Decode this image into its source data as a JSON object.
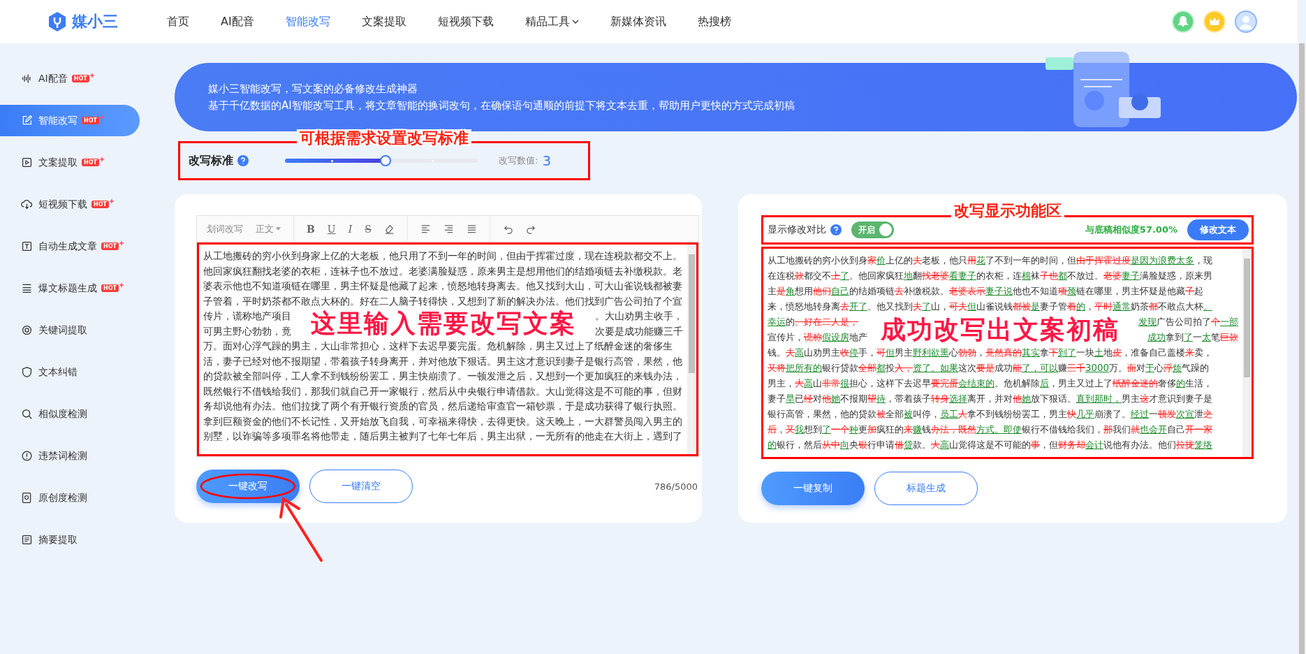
{
  "header": {
    "logo_text": "媒小三",
    "nav": [
      {
        "label": "首页",
        "selected": false,
        "dropdown": false
      },
      {
        "label": "AI配音",
        "selected": false,
        "dropdown": false
      },
      {
        "label": "智能改写",
        "selected": true,
        "dropdown": false
      },
      {
        "label": "文案提取",
        "selected": false,
        "dropdown": false
      },
      {
        "label": "短视频下载",
        "selected": false,
        "dropdown": false
      },
      {
        "label": "精品工具",
        "selected": false,
        "dropdown": true
      },
      {
        "label": "新媒体资讯",
        "selected": false,
        "dropdown": false
      },
      {
        "label": "热搜榜",
        "selected": false,
        "dropdown": false
      }
    ]
  },
  "sidebar": {
    "items": [
      {
        "label": "AI配音",
        "badge": "HOT",
        "selected": false
      },
      {
        "label": "智能改写",
        "badge": "HOT",
        "selected": true
      },
      {
        "label": "文案提取",
        "badge": "HOT",
        "selected": false
      },
      {
        "label": "短视频下载",
        "badge": "HOT",
        "selected": false
      },
      {
        "label": "自动生成文章",
        "badge": "HOT",
        "selected": false
      },
      {
        "label": "爆文标题生成",
        "badge": "HOT",
        "selected": false
      },
      {
        "label": "关键词提取",
        "selected": false
      },
      {
        "label": "文本纠错",
        "selected": false
      },
      {
        "label": "相似度检测",
        "selected": false
      },
      {
        "label": "违禁词检测",
        "selected": false
      },
      {
        "label": "原创度检测",
        "selected": false
      },
      {
        "label": "摘要提取",
        "selected": false
      }
    ]
  },
  "banner": {
    "title": "媒小三智能改写，写文案的必备修改生成神器",
    "subtitle": "基于千亿数据的AI智能改写工具，将文章智能的换词改句，在确保语句通顺的前提下将文本去重，帮助用户更快的方式完成初稿"
  },
  "rewrite_standard": {
    "label": "改写标准",
    "level": 0.5,
    "value_label": "改写数值:",
    "value": "3",
    "annotation": "可根据需求设置改写标准"
  },
  "editor": {
    "toolbar": {
      "mode": "划词改写",
      "style": "正文",
      "format_buttons": [
        {
          "kind": "bold",
          "label": "B"
        },
        {
          "kind": "underline",
          "label": "U"
        },
        {
          "kind": "italic",
          "label": "I"
        },
        {
          "kind": "strike",
          "label": "S"
        }
      ]
    },
    "annotation": "这里输入需要改写文案",
    "lines": [
      {
        "text": "从工地搬砖的穷小伙到身家上亿的大老板，他只用了不到一年的时间，但由于挥霍过度，现在连税款都交不上。"
      },
      {
        "text": "他回家疯狂翻找老婆的衣柜，连袜子也不放过。老婆满脸疑惑，原来男主是想用他们的结婚项链去补缴税款。老"
      },
      {
        "text": "婆表示他也不知道项链在哪里，男主怀疑是他藏了起来，愤怒地转身离去。他又找到大山，可大山雀说钱都被妻"
      },
      {
        "text": "子管着，平时奶茶都不敢点大杯的。好在二人脑子转得快，又想到了新的解决办法。他们找到广告公司拍了个宣"
      },
      {
        "text": "传片，谎称地产项目",
        "after_overlay": "。大山劝男主收手，"
      },
      {
        "text": "可男主野心勃勃，竟",
        "after_overlay": "次要是成功能赚三千"
      },
      {
        "text": "万。面对心浮气躁的男主，大山非常担心，这样下去迟早要完蛋。危机解除，男主又过上了纸醉金迷的奢侈生"
      },
      {
        "text": "活，妻子已经对他不报期望，带着孩子转身离开，并对他放下狠话。男主这才意识到妻子是银行高管，果然，他"
      },
      {
        "text": "的贷款被全部叫停，工人拿不到钱纷纷罢工，男主快崩溃了。一顿发泄之后，又想到一个更加疯狂的来钱办法，"
      },
      {
        "text": "既然银行不借钱给我们，那我们就自己开一家银行，然后从中央银行申请借款。大山觉得这是不可能的事，但财"
      },
      {
        "text": "务却说他有办法。他们拉拢了两个有开银行资质的官员，然后递给审查官一箱钞票，于是成功获得了银行执照。"
      },
      {
        "text": "拿到巨额资金的他们不长记性，又开始放飞自我，可幸福来得快，去得更快。这天晚上，一大群警员闯入男主的"
      },
      {
        "text": "别墅，以诈骗等多项罪名将他带走，随后男主被判了七年七年后，男主出狱，一无所有的他走在大街上，遇到了"
      }
    ],
    "buttons": [
      {
        "label": "一键改写",
        "kind": "primary"
      },
      {
        "label": "一键清空",
        "kind": "outline"
      }
    ],
    "count": "786/5000",
    "primary_annotated": true
  },
  "result": {
    "compare_label": "显示修改对比",
    "compare_on": true,
    "toggle_label": "开启",
    "similarity": "与底稿相似度57.00%",
    "edit_button": "修改文本",
    "annotation": "改写显示功能区",
    "overlay_annotation": "成功改写出文案初稿",
    "lines": [
      {
        "segments": [
          {
            "kind": "same",
            "text": "从工地搬砖的穷小伙到身"
          },
          {
            "kind": "deleted",
            "text": "家"
          },
          {
            "kind": "added",
            "text": "价"
          },
          {
            "kind": "same",
            "text": "上亿的"
          },
          {
            "kind": "deleted",
            "text": "夫"
          },
          {
            "kind": "same",
            "text": "老板，他只"
          },
          {
            "kind": "deleted",
            "text": "用"
          },
          {
            "kind": "added",
            "text": "花"
          },
          {
            "kind": "same",
            "text": "了不到一年的时间，但"
          },
          {
            "kind": "deleted",
            "text": "由于挥霍过度"
          },
          {
            "kind": "added",
            "text": "是因为浪费太多"
          },
          {
            "kind": "same",
            "text": "，现"
          }
        ]
      },
      {
        "segments": [
          {
            "kind": "same",
            "text": "在连税"
          },
          {
            "kind": "deleted",
            "text": "款"
          },
          {
            "kind": "same",
            "text": "都交不"
          },
          {
            "kind": "deleted",
            "text": "上"
          },
          {
            "kind": "added",
            "text": "了"
          },
          {
            "kind": "same",
            "text": "。他回家疯狂"
          },
          {
            "kind": "added",
            "text": "地"
          },
          {
            "kind": "same",
            "text": "翻"
          },
          {
            "kind": "deleted",
            "text": "找老婆"
          },
          {
            "kind": "added",
            "text": "看妻子"
          },
          {
            "kind": "same",
            "text": "的衣柜，连"
          },
          {
            "kind": "added",
            "text": "棉"
          },
          {
            "kind": "same",
            "text": "袜"
          },
          {
            "kind": "deleted",
            "text": "子也"
          },
          {
            "kind": "added",
            "text": "都"
          },
          {
            "kind": "same",
            "text": "不放过。"
          },
          {
            "kind": "deleted",
            "text": "老婆"
          },
          {
            "kind": "added",
            "text": "妻子"
          },
          {
            "kind": "same",
            "text": "满脸疑惑，原来男"
          }
        ]
      },
      {
        "segments": [
          {
            "kind": "same",
            "text": "主"
          },
          {
            "kind": "deleted",
            "text": "是"
          },
          {
            "kind": "added",
            "text": "角"
          },
          {
            "kind": "same",
            "text": "想用"
          },
          {
            "kind": "deleted",
            "text": "他们"
          },
          {
            "kind": "added",
            "text": "自己"
          },
          {
            "kind": "same",
            "text": "的结婚项链"
          },
          {
            "kind": "deleted",
            "text": "去"
          },
          {
            "kind": "same",
            "text": "补缴税款。"
          },
          {
            "kind": "deleted",
            "text": "老婆表示"
          },
          {
            "kind": "added",
            "text": "妻子说"
          },
          {
            "kind": "same",
            "text": "他也不知道"
          },
          {
            "kind": "deleted",
            "text": "项"
          },
          {
            "kind": "added",
            "text": "颈"
          },
          {
            "kind": "same",
            "text": "链在哪里，男主怀疑是他藏"
          },
          {
            "kind": "deleted",
            "text": "子"
          },
          {
            "kind": "same",
            "text": "起"
          }
        ]
      },
      {
        "segments": [
          {
            "kind": "same",
            "text": "来，愤怒地转身离"
          },
          {
            "kind": "deleted",
            "text": "去"
          },
          {
            "kind": "added",
            "text": "开了"
          },
          {
            "kind": "same",
            "text": "。他又找到"
          },
          {
            "kind": "deleted",
            "text": "夫"
          },
          {
            "kind": "added",
            "text": "了"
          },
          {
            "kind": "same",
            "text": "山，"
          },
          {
            "kind": "deleted",
            "text": "可夫"
          },
          {
            "kind": "added",
            "text": "但"
          },
          {
            "kind": "same",
            "text": "山雀说钱"
          },
          {
            "kind": "deleted",
            "text": "都被"
          },
          {
            "kind": "added",
            "text": "是"
          },
          {
            "kind": "same",
            "text": "妻子管"
          },
          {
            "kind": "deleted",
            "text": "着"
          },
          {
            "kind": "added",
            "text": "的"
          },
          {
            "kind": "same",
            "text": "，"
          },
          {
            "kind": "deleted",
            "text": "平时"
          },
          {
            "kind": "added",
            "text": "通常"
          },
          {
            "kind": "same",
            "text": "奶茶"
          },
          {
            "kind": "deleted",
            "text": "都"
          },
          {
            "kind": "same",
            "text": "不敢点大杯"
          },
          {
            "kind": "added",
            "text": "。"
          }
        ]
      },
      {
        "segments": [
          {
            "kind": "added",
            "text": "幸运"
          },
          {
            "kind": "same",
            "text": "的"
          },
          {
            "kind": "deleted",
            "text": "。好在二人是，"
          }
        ],
        "segments_after_overlay": [
          {
            "kind": "added",
            "text": "发现"
          },
          {
            "kind": "same",
            "text": "广告公司拍了"
          },
          {
            "kind": "deleted",
            "text": "个"
          },
          {
            "kind": "added",
            "text": "一部"
          }
        ]
      },
      {
        "segments": [
          {
            "kind": "same",
            "text": "宣传片，"
          },
          {
            "kind": "deleted",
            "text": "谎称"
          },
          {
            "kind": "added",
            "text": "假设房"
          },
          {
            "kind": "same",
            "text": "地产"
          }
        ],
        "segments_after_overlay": [
          {
            "kind": "added",
            "text": "成功"
          },
          {
            "kind": "same",
            "text": "拿到"
          },
          {
            "kind": "added",
            "text": "了"
          },
          {
            "kind": "same",
            "text": "一"
          },
          {
            "kind": "added",
            "text": "太"
          },
          {
            "kind": "same",
            "text": "笔"
          },
          {
            "kind": "deleted",
            "text": "巨款"
          }
        ]
      },
      {
        "segments": [
          {
            "kind": "same",
            "text": "钱。"
          },
          {
            "kind": "deleted",
            "text": "夫"
          },
          {
            "kind": "added",
            "text": "高"
          },
          {
            "kind": "same",
            "text": "山劝男主"
          },
          {
            "kind": "deleted",
            "text": "收"
          },
          {
            "kind": "added",
            "text": "停"
          },
          {
            "kind": "same",
            "text": "手，"
          },
          {
            "kind": "deleted",
            "text": "可"
          },
          {
            "kind": "added",
            "text": "但"
          },
          {
            "kind": "same",
            "text": "男主"
          },
          {
            "kind": "added",
            "text": "野利欲熏"
          },
          {
            "kind": "same",
            "text": "心"
          },
          {
            "kind": "deleted",
            "text": "勃勃"
          },
          {
            "kind": "same",
            "text": "，"
          },
          {
            "kind": "deleted",
            "text": "竟然真的"
          },
          {
            "kind": "added",
            "text": "其实"
          },
          {
            "kind": "same",
            "text": "拿"
          },
          {
            "kind": "deleted",
            "text": "下"
          },
          {
            "kind": "added",
            "text": "到了"
          },
          {
            "kind": "same",
            "text": "一块"
          },
          {
            "kind": "added",
            "text": "土"
          },
          {
            "kind": "same",
            "text": "地"
          },
          {
            "kind": "deleted",
            "text": "皮"
          },
          {
            "kind": "same",
            "text": "，准备自己盖楼"
          },
          {
            "kind": "deleted",
            "text": "来"
          },
          {
            "kind": "same",
            "text": "卖，"
          }
        ]
      },
      {
        "segments": [
          {
            "kind": "deleted",
            "text": "又将"
          },
          {
            "kind": "added",
            "text": "把所有的"
          },
          {
            "kind": "same",
            "text": "银行贷款"
          },
          {
            "kind": "deleted",
            "text": "全部"
          },
          {
            "kind": "added",
            "text": "都"
          },
          {
            "kind": "same",
            "text": "投"
          },
          {
            "kind": "deleted",
            "text": "入，"
          },
          {
            "kind": "added",
            "text": "资了。如果"
          },
          {
            "kind": "same",
            "text": "这次"
          },
          {
            "kind": "deleted",
            "text": "要是"
          },
          {
            "kind": "same",
            "text": "成功"
          },
          {
            "kind": "deleted",
            "text": "能"
          },
          {
            "kind": "added",
            "text": "了，可以"
          },
          {
            "kind": "same",
            "text": "赚"
          },
          {
            "kind": "deleted",
            "text": "三千"
          },
          {
            "kind": "added",
            "text": "3000"
          },
          {
            "kind": "same",
            "text": "万。"
          },
          {
            "kind": "deleted",
            "text": "面"
          },
          {
            "kind": "same",
            "text": "对"
          },
          {
            "kind": "added",
            "text": "于"
          },
          {
            "kind": "same",
            "text": "心"
          },
          {
            "kind": "deleted",
            "text": "浮"
          },
          {
            "kind": "added",
            "text": "烦"
          },
          {
            "kind": "same",
            "text": "气躁的"
          }
        ]
      },
      {
        "segments": [
          {
            "kind": "same",
            "text": "男主，"
          },
          {
            "kind": "deleted",
            "text": "大"
          },
          {
            "kind": "added",
            "text": "高"
          },
          {
            "kind": "same",
            "text": "山"
          },
          {
            "kind": "deleted",
            "text": "非常"
          },
          {
            "kind": "added",
            "text": "很"
          },
          {
            "kind": "same",
            "text": "担心，这样下去迟早"
          },
          {
            "kind": "deleted",
            "text": "要完蛋"
          },
          {
            "kind": "added",
            "text": "会结束的"
          },
          {
            "kind": "same",
            "text": "。危机解除"
          },
          {
            "kind": "added",
            "text": "后"
          },
          {
            "kind": "same",
            "text": "，男主又过上了"
          },
          {
            "kind": "deleted",
            "text": "纸醉金迷的"
          },
          {
            "kind": "same",
            "text": "奢侈"
          },
          {
            "kind": "added",
            "text": "的"
          },
          {
            "kind": "same",
            "text": "生活，"
          }
        ]
      },
      {
        "segments": [
          {
            "kind": "same",
            "text": "妻子"
          },
          {
            "kind": "added",
            "text": "早"
          },
          {
            "kind": "same",
            "text": "已"
          },
          {
            "kind": "deleted",
            "text": "经"
          },
          {
            "kind": "same",
            "text": "对"
          },
          {
            "kind": "deleted",
            "text": "他"
          },
          {
            "kind": "added",
            "text": "她"
          },
          {
            "kind": "same",
            "text": "不报期"
          },
          {
            "kind": "deleted",
            "text": "望"
          },
          {
            "kind": "added",
            "text": "待"
          },
          {
            "kind": "same",
            "text": "，带着孩子"
          },
          {
            "kind": "deleted",
            "text": "转身"
          },
          {
            "kind": "added",
            "text": "选择"
          },
          {
            "kind": "same",
            "text": "离开，并对"
          },
          {
            "kind": "deleted",
            "text": "他"
          },
          {
            "kind": "added",
            "text": "她"
          },
          {
            "kind": "same",
            "text": "放下狠话。"
          },
          {
            "kind": "added",
            "text": "直到那时，"
          },
          {
            "kind": "same",
            "text": "男主"
          },
          {
            "kind": "deleted",
            "text": "这"
          },
          {
            "kind": "same",
            "text": "才意识到妻子是"
          }
        ]
      },
      {
        "segments": [
          {
            "kind": "same",
            "text": "银行高管，果然，他的贷款"
          },
          {
            "kind": "deleted",
            "text": "被"
          },
          {
            "kind": "same",
            "text": "全部"
          },
          {
            "kind": "added",
            "text": "被"
          },
          {
            "kind": "same",
            "text": "叫停，"
          },
          {
            "kind": "added",
            "text": "员工"
          },
          {
            "kind": "deleted",
            "text": "人"
          },
          {
            "kind": "same",
            "text": "拿不到钱纷纷罢工，男主"
          },
          {
            "kind": "deleted",
            "text": "快"
          },
          {
            "kind": "added",
            "text": "几乎"
          },
          {
            "kind": "same",
            "text": "崩溃了。"
          },
          {
            "kind": "added",
            "text": "经过"
          },
          {
            "kind": "same",
            "text": "一"
          },
          {
            "kind": "deleted",
            "text": "顿发"
          },
          {
            "kind": "added",
            "text": "次宣"
          },
          {
            "kind": "same",
            "text": "泄"
          },
          {
            "kind": "deleted",
            "text": "之"
          }
        ]
      },
      {
        "segments": [
          {
            "kind": "deleted",
            "text": "后"
          },
          {
            "kind": "same",
            "text": "，"
          },
          {
            "kind": "deleted",
            "text": "又"
          },
          {
            "kind": "added",
            "text": "我"
          },
          {
            "kind": "same",
            "text": "想到"
          },
          {
            "kind": "added",
            "text": "了"
          },
          {
            "kind": "deleted",
            "text": "一个"
          },
          {
            "kind": "added",
            "text": "种"
          },
          {
            "kind": "same",
            "text": "更"
          },
          {
            "kind": "deleted",
            "text": "加"
          },
          {
            "kind": "same",
            "text": "疯狂的"
          },
          {
            "kind": "deleted",
            "text": "来"
          },
          {
            "kind": "added",
            "text": "赚"
          },
          {
            "kind": "same",
            "text": "钱"
          },
          {
            "kind": "deleted",
            "text": "办法，既然"
          },
          {
            "kind": "added",
            "text": "方式。即使"
          },
          {
            "kind": "same",
            "text": "银行不借钱给我们，"
          },
          {
            "kind": "deleted",
            "text": "那"
          },
          {
            "kind": "same",
            "text": "我们"
          },
          {
            "kind": "deleted",
            "text": "就"
          },
          {
            "kind": "added",
            "text": "也会开"
          },
          {
            "kind": "same",
            "text": "自己"
          },
          {
            "kind": "deleted",
            "text": "开一家"
          }
        ]
      },
      {
        "segments": [
          {
            "kind": "added",
            "text": "的"
          },
          {
            "kind": "same",
            "text": "银行，然后"
          },
          {
            "kind": "deleted",
            "text": "从中"
          },
          {
            "kind": "added",
            "text": "向"
          },
          {
            "kind": "same",
            "text": "央"
          },
          {
            "kind": "deleted",
            "text": "银"
          },
          {
            "kind": "same",
            "text": "行申请"
          },
          {
            "kind": "deleted",
            "text": "借"
          },
          {
            "kind": "added",
            "text": "贷"
          },
          {
            "kind": "same",
            "text": "款。"
          },
          {
            "kind": "deleted",
            "text": "大"
          },
          {
            "kind": "added",
            "text": "高"
          },
          {
            "kind": "same",
            "text": "山觉得这是不可能的"
          },
          {
            "kind": "deleted",
            "text": "事"
          },
          {
            "kind": "same",
            "text": "，但"
          },
          {
            "kind": "deleted",
            "text": "财务却"
          },
          {
            "kind": "added",
            "text": "会计"
          },
          {
            "kind": "same",
            "text": "说他有办法。他们"
          },
          {
            "kind": "deleted",
            "text": "拉拢"
          },
          {
            "kind": "added",
            "text": "笼络"
          }
        ]
      }
    ],
    "buttons": [
      {
        "label": "一键复制",
        "kind": "primary"
      },
      {
        "label": "标题生成",
        "kind": "outline"
      }
    ]
  }
}
